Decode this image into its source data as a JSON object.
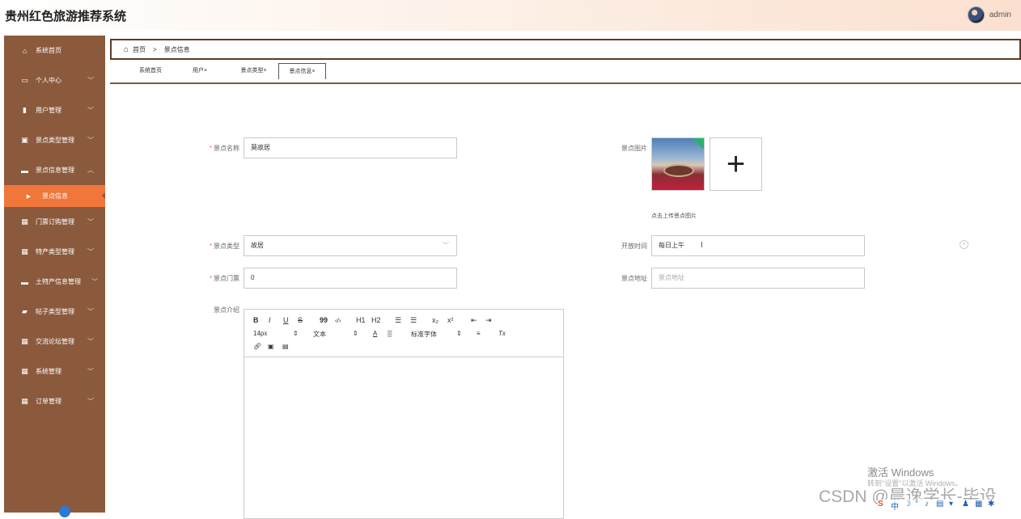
{
  "header": {
    "app_title": "贵州红色旅游推荐系统",
    "user_name": "admin"
  },
  "sidebar": {
    "items": [
      {
        "label": "系统首页",
        "icon": "home-icon"
      },
      {
        "label": "个人中心",
        "icon": "profile-card-icon"
      },
      {
        "label": "用户管理",
        "icon": "book-icon"
      },
      {
        "label": "景点类型管理",
        "icon": "clipboard-icon"
      },
      {
        "label": "景点信息管理",
        "icon": "monitor-icon"
      },
      {
        "label": "景点信息",
        "icon": "caret-right-icon"
      },
      {
        "label": "门票订购管理",
        "icon": "grid-icon"
      },
      {
        "label": "特产类型管理",
        "icon": "grid-icon"
      },
      {
        "label": "土特产信息管理",
        "icon": "monitor-icon"
      },
      {
        "label": "帖子类型管理",
        "icon": "chat-icon"
      },
      {
        "label": "交流论坛管理",
        "icon": "grid-icon"
      },
      {
        "label": "系统管理",
        "icon": "grid-icon"
      },
      {
        "label": "订单管理",
        "icon": "grid-icon"
      }
    ]
  },
  "breadcrumb": {
    "home": "首页",
    "separator": ">",
    "current": "景点信息"
  },
  "tabs": [
    {
      "label": "系统首页",
      "active": false
    },
    {
      "label": "用户",
      "active": false
    },
    {
      "label": "景点类型",
      "active": false
    },
    {
      "label": "景点信息",
      "active": true
    }
  ],
  "form": {
    "name_label": "景点名称",
    "name_value": "莫故居",
    "image_label": "景点图片",
    "upload_hint": "点击上传景点图片",
    "type_label": "景点类型",
    "type_value": "故居",
    "open_time_label": "开放时间",
    "open_time_value": "每日上午",
    "ticket_label": "景点门票",
    "ticket_value": "0",
    "address_label": "景点地址",
    "address_placeholder": "景点地址",
    "intro_label": "景点介绍"
  },
  "editor": {
    "toolbar": {
      "bold": "B",
      "italic": "I",
      "underline": "U",
      "strike": "S",
      "quote": "99",
      "code": "‹/›",
      "h1": "H1",
      "h2": "H2",
      "ordered": "☰",
      "bullet": "☰",
      "sub": "x₂",
      "sup": "x²",
      "outdent": "⇤",
      "indent": "⇥",
      "font_size": "14px",
      "paragraph": "文本",
      "font_family": "标准字体",
      "align": "≡",
      "clean": "Tx"
    }
  },
  "watermarks": {
    "activate_title": "激活 Windows",
    "activate_sub": "转到\"设置\"以激活 Windows。",
    "csdn": "CSDN @晨逸学长-毕设"
  },
  "colors": {
    "sidebar_bg": "#8b5a3c",
    "sidebar_active": "#f0763a",
    "header_gradient_end": "#fbe0cf",
    "required": "#f56c6c"
  }
}
